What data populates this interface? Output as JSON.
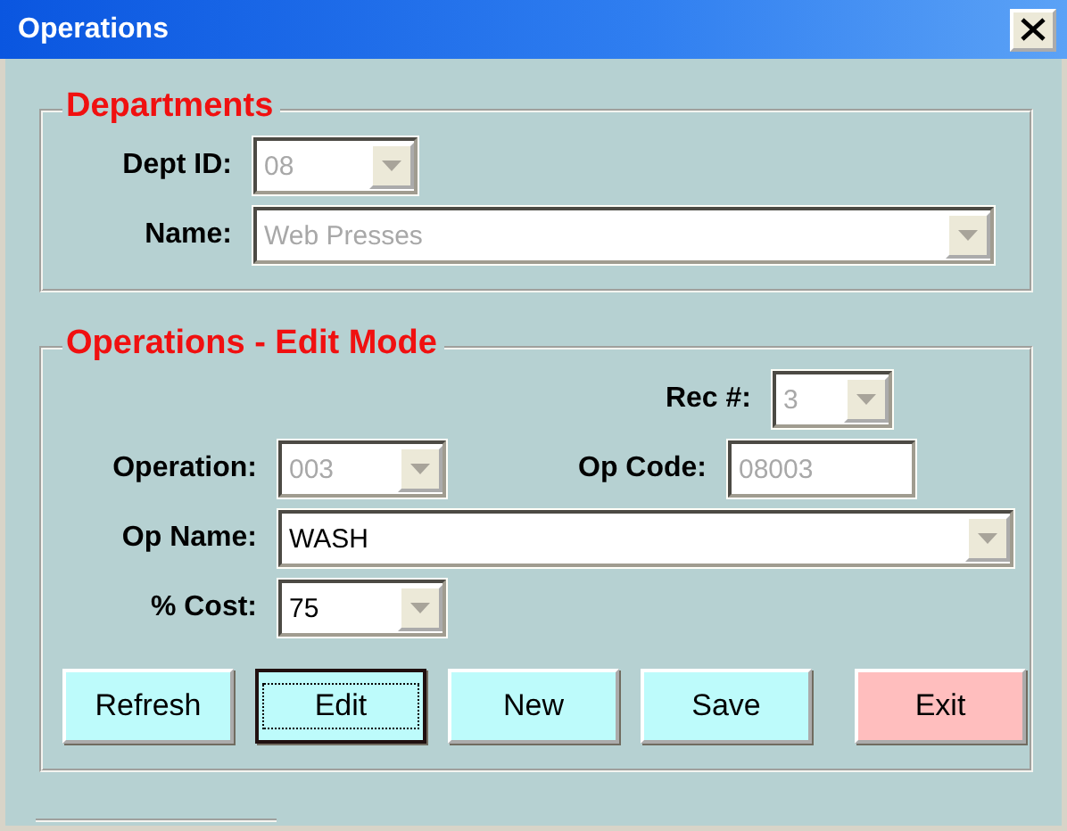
{
  "window": {
    "title": "Operations"
  },
  "departments": {
    "title": "Departments",
    "fields": [
      {
        "label": "Dept ID:",
        "kind": "combo",
        "value": "08",
        "disabled": true
      },
      {
        "label": "Name:",
        "kind": "combo",
        "value": "Web Presses",
        "disabled": true
      }
    ]
  },
  "operations": {
    "title": "Operations - Edit Mode",
    "fields": [
      {
        "label": "Rec #:",
        "kind": "combo",
        "value": "3",
        "disabled": true
      },
      {
        "label": "Operation:",
        "kind": "combo",
        "value": "003",
        "disabled": true
      },
      {
        "label": "Op Code:",
        "kind": "text",
        "value": "08003",
        "disabled": true
      },
      {
        "label": "Op Name:",
        "kind": "combo",
        "value": "WASH",
        "disabled": false
      },
      {
        "label": "% Cost:",
        "kind": "combo",
        "value": "75",
        "disabled": false
      }
    ]
  },
  "buttons": [
    {
      "label": "Refresh",
      "kind": "normal",
      "focused": false
    },
    {
      "label": "Edit",
      "kind": "normal",
      "focused": true
    },
    {
      "label": "New",
      "kind": "normal",
      "focused": false
    },
    {
      "label": "Save",
      "kind": "normal",
      "focused": false
    },
    {
      "label": "Exit",
      "kind": "exit",
      "focused": false
    }
  ]
}
